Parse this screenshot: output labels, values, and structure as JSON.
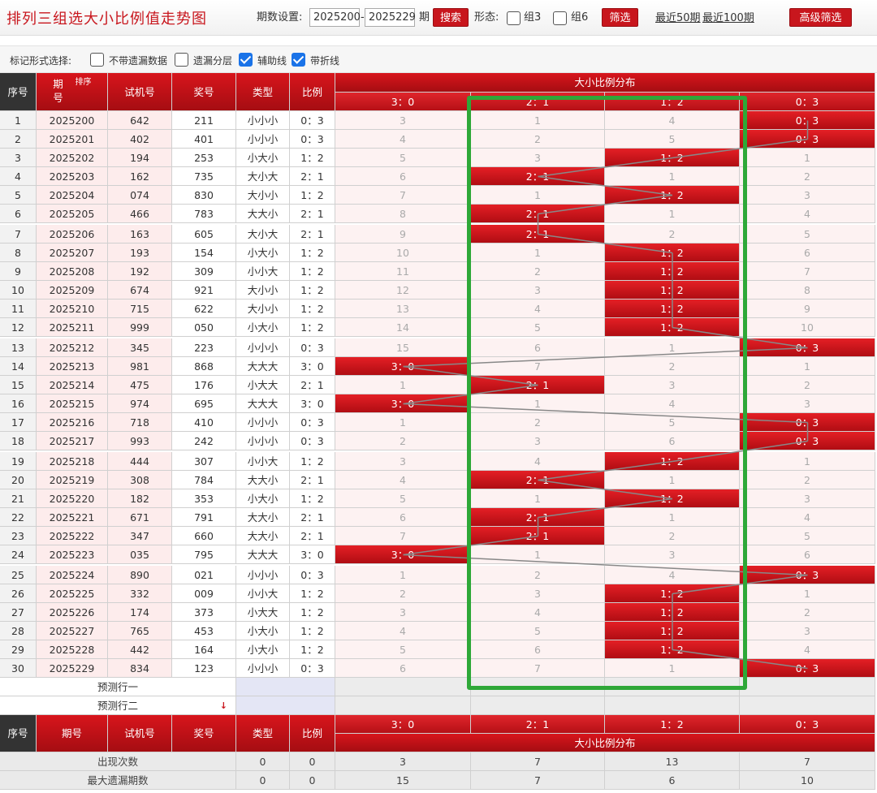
{
  "header": {
    "title": "排列三组选大小比例值走势图",
    "period_label": "期数设置:",
    "period_from": "2025200",
    "period_sep": "-",
    "period_to": "2025229",
    "period_suffix": "期",
    "search_label": "搜索",
    "form_label": "形态:",
    "group3_label": "组3",
    "group6_label": "组6",
    "filter_label": "筛选",
    "recent50": "最近50期",
    "recent100": "最近100期",
    "advanced": "高级筛选"
  },
  "options": {
    "label": "标记形式选择:",
    "items": [
      {
        "label": "不带遗漏数据",
        "checked": false
      },
      {
        "label": "遗漏分层",
        "checked": false
      },
      {
        "label": "辅助线",
        "checked": true
      },
      {
        "label": "带折线",
        "checked": true
      }
    ]
  },
  "table": {
    "headers": {
      "seq": "序号",
      "period": "期号",
      "sort": "排序",
      "trial": "试机号",
      "prize": "奖号",
      "type": "类型",
      "ratio": "比例",
      "dist": "大小比例分布"
    },
    "ratio_columns": [
      "3:0",
      "2:1",
      "1:2",
      "0:3"
    ],
    "rows": [
      {
        "seq": "1",
        "period": "2025200",
        "trial": "642",
        "prize": "211",
        "type": "小小小",
        "ratio": "0:3",
        "dist": [
          "3",
          "1",
          "4",
          "0:3"
        ]
      },
      {
        "seq": "2",
        "period": "2025201",
        "trial": "402",
        "prize": "401",
        "type": "小小小",
        "ratio": "0:3",
        "dist": [
          "4",
          "2",
          "5",
          "0:3"
        ]
      },
      {
        "seq": "3",
        "period": "2025202",
        "trial": "194",
        "prize": "253",
        "type": "小大小",
        "ratio": "1:2",
        "dist": [
          "5",
          "3",
          "1:2",
          "1"
        ]
      },
      {
        "seq": "4",
        "period": "2025203",
        "trial": "162",
        "prize": "735",
        "type": "大小大",
        "ratio": "2:1",
        "dist": [
          "6",
          "2:1",
          "1",
          "2"
        ]
      },
      {
        "seq": "5",
        "period": "2025204",
        "trial": "074",
        "prize": "830",
        "type": "大小小",
        "ratio": "1:2",
        "dist": [
          "7",
          "1",
          "1:2",
          "3"
        ]
      },
      {
        "seq": "6",
        "period": "2025205",
        "trial": "466",
        "prize": "783",
        "type": "大大小",
        "ratio": "2:1",
        "dist": [
          "8",
          "2:1",
          "1",
          "4"
        ]
      },
      {
        "seq": "7",
        "period": "2025206",
        "trial": "163",
        "prize": "605",
        "type": "大小大",
        "ratio": "2:1",
        "dist": [
          "9",
          "2:1",
          "2",
          "5"
        ]
      },
      {
        "seq": "8",
        "period": "2025207",
        "trial": "193",
        "prize": "154",
        "type": "小大小",
        "ratio": "1:2",
        "dist": [
          "10",
          "1",
          "1:2",
          "6"
        ]
      },
      {
        "seq": "9",
        "period": "2025208",
        "trial": "192",
        "prize": "309",
        "type": "小小大",
        "ratio": "1:2",
        "dist": [
          "11",
          "2",
          "1:2",
          "7"
        ]
      },
      {
        "seq": "10",
        "period": "2025209",
        "trial": "674",
        "prize": "921",
        "type": "大小小",
        "ratio": "1:2",
        "dist": [
          "12",
          "3",
          "1:2",
          "8"
        ]
      },
      {
        "seq": "11",
        "period": "2025210",
        "trial": "715",
        "prize": "622",
        "type": "大小小",
        "ratio": "1:2",
        "dist": [
          "13",
          "4",
          "1:2",
          "9"
        ]
      },
      {
        "seq": "12",
        "period": "2025211",
        "trial": "999",
        "prize": "050",
        "type": "小大小",
        "ratio": "1:2",
        "dist": [
          "14",
          "5",
          "1:2",
          "10"
        ]
      },
      {
        "seq": "13",
        "period": "2025212",
        "trial": "345",
        "prize": "223",
        "type": "小小小",
        "ratio": "0:3",
        "dist": [
          "15",
          "6",
          "1",
          "0:3"
        ]
      },
      {
        "seq": "14",
        "period": "2025213",
        "trial": "981",
        "prize": "868",
        "type": "大大大",
        "ratio": "3:0",
        "dist": [
          "3:0",
          "7",
          "2",
          "1"
        ]
      },
      {
        "seq": "15",
        "period": "2025214",
        "trial": "475",
        "prize": "176",
        "type": "小大大",
        "ratio": "2:1",
        "dist": [
          "1",
          "2:1",
          "3",
          "2"
        ]
      },
      {
        "seq": "16",
        "period": "2025215",
        "trial": "974",
        "prize": "695",
        "type": "大大大",
        "ratio": "3:0",
        "dist": [
          "3:0",
          "1",
          "4",
          "3"
        ]
      },
      {
        "seq": "17",
        "period": "2025216",
        "trial": "718",
        "prize": "410",
        "type": "小小小",
        "ratio": "0:3",
        "dist": [
          "1",
          "2",
          "5",
          "0:3"
        ]
      },
      {
        "seq": "18",
        "period": "2025217",
        "trial": "993",
        "prize": "242",
        "type": "小小小",
        "ratio": "0:3",
        "dist": [
          "2",
          "3",
          "6",
          "0:3"
        ]
      },
      {
        "seq": "19",
        "period": "2025218",
        "trial": "444",
        "prize": "307",
        "type": "小小大",
        "ratio": "1:2",
        "dist": [
          "3",
          "4",
          "1:2",
          "1"
        ]
      },
      {
        "seq": "20",
        "period": "2025219",
        "trial": "308",
        "prize": "784",
        "type": "大大小",
        "ratio": "2:1",
        "dist": [
          "4",
          "2:1",
          "1",
          "2"
        ]
      },
      {
        "seq": "21",
        "period": "2025220",
        "trial": "182",
        "prize": "353",
        "type": "小大小",
        "ratio": "1:2",
        "dist": [
          "5",
          "1",
          "1:2",
          "3"
        ]
      },
      {
        "seq": "22",
        "period": "2025221",
        "trial": "671",
        "prize": "791",
        "type": "大大小",
        "ratio": "2:1",
        "dist": [
          "6",
          "2:1",
          "1",
          "4"
        ]
      },
      {
        "seq": "23",
        "period": "2025222",
        "trial": "347",
        "prize": "660",
        "type": "大大小",
        "ratio": "2:1",
        "dist": [
          "7",
          "2:1",
          "2",
          "5"
        ]
      },
      {
        "seq": "24",
        "period": "2025223",
        "trial": "035",
        "prize": "795",
        "type": "大大大",
        "ratio": "3:0",
        "dist": [
          "3:0",
          "1",
          "3",
          "6"
        ]
      },
      {
        "seq": "25",
        "period": "2025224",
        "trial": "890",
        "prize": "021",
        "type": "小小小",
        "ratio": "0:3",
        "dist": [
          "1",
          "2",
          "4",
          "0:3"
        ]
      },
      {
        "seq": "26",
        "period": "2025225",
        "trial": "332",
        "prize": "009",
        "type": "小小大",
        "ratio": "1:2",
        "dist": [
          "2",
          "3",
          "1:2",
          "1"
        ]
      },
      {
        "seq": "27",
        "period": "2025226",
        "trial": "174",
        "prize": "373",
        "type": "小大大",
        "ratio": "1:2",
        "dist": [
          "3",
          "4",
          "1:2",
          "2"
        ]
      },
      {
        "seq": "28",
        "period": "2025227",
        "trial": "765",
        "prize": "453",
        "type": "小大小",
        "ratio": "1:2",
        "dist": [
          "4",
          "5",
          "1:2",
          "3"
        ]
      },
      {
        "seq": "29",
        "period": "2025228",
        "trial": "442",
        "prize": "164",
        "type": "小大小",
        "ratio": "1:2",
        "dist": [
          "5",
          "6",
          "1:2",
          "4"
        ]
      },
      {
        "seq": "30",
        "period": "2025229",
        "trial": "834",
        "prize": "123",
        "type": "小小小",
        "ratio": "0:3",
        "dist": [
          "6",
          "7",
          "1",
          "0:3"
        ]
      }
    ],
    "predict1": "预测行一",
    "predict2": "预测行二",
    "footer_headers": {
      "seq": "序号",
      "period": "期号",
      "trial": "试机号",
      "prize": "奖号",
      "type": "类型",
      "ratio": "比例",
      "dist": "大小比例分布"
    },
    "stats": [
      {
        "label": "出现次数",
        "type": "0",
        "ratio": "0",
        "values": [
          "3",
          "7",
          "13",
          "7"
        ]
      },
      {
        "label": "最大遗漏期数",
        "type": "0",
        "ratio": "0",
        "values": [
          "15",
          "7",
          "6",
          "10"
        ]
      }
    ]
  },
  "colors": {
    "accent": "#c8161d",
    "highlight": "#2ea838",
    "line": "#888888"
  }
}
